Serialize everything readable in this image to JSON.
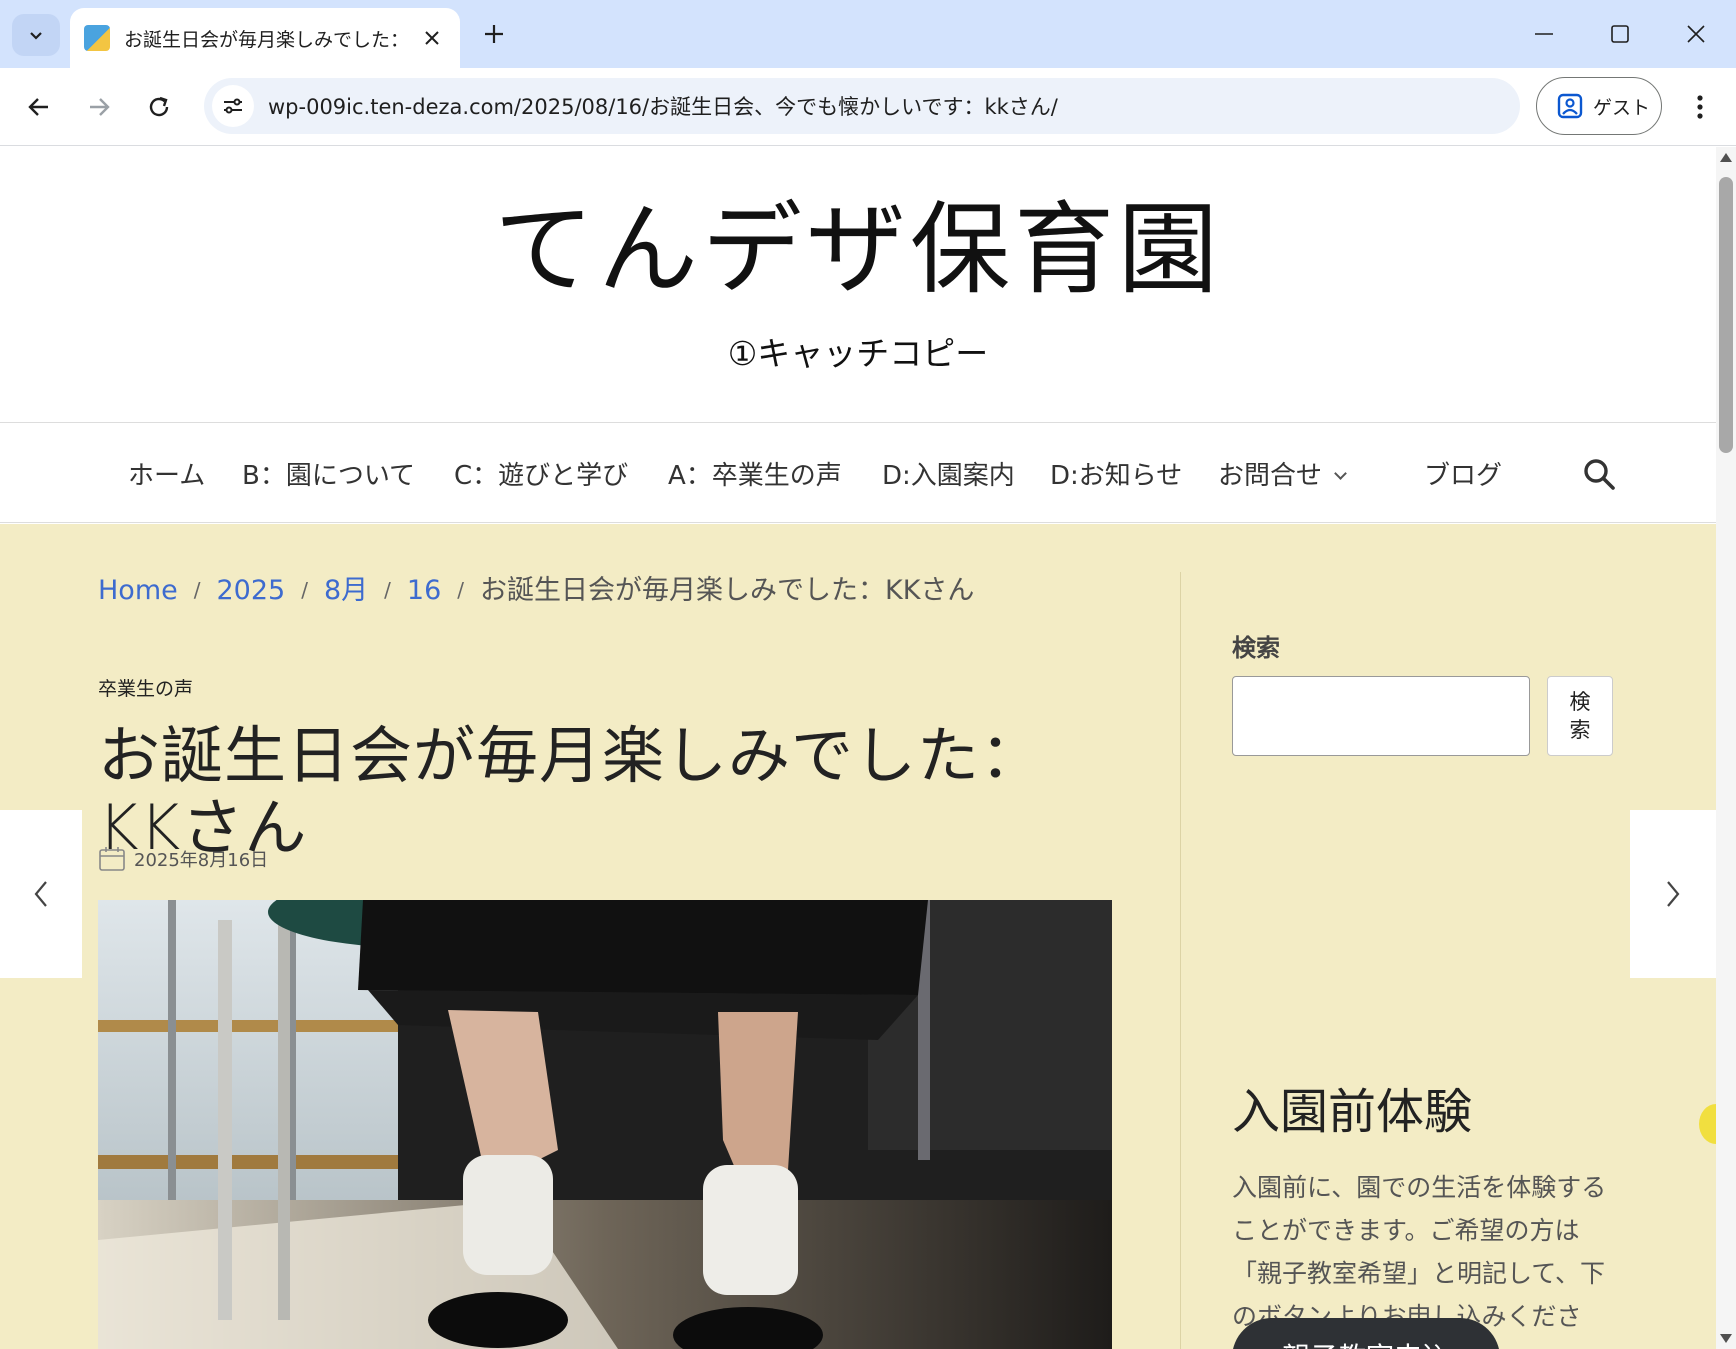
{
  "browser": {
    "tab_title": "お誕生日会が毎月楽しみでした：KKさん",
    "url": "wp-009ic.ten-deza.com/2025/08/16/お誕生日会、今でも懐かしいです：kkさん/",
    "profile_label": "ゲスト"
  },
  "site": {
    "title": "てんデザ保育園",
    "tagline": "①キャッチコピー"
  },
  "nav": {
    "items": [
      "ホーム",
      "B：園について",
      "C：遊びと学び",
      "A：卒業生の声",
      "D:入園案内",
      "D:お知らせ",
      "お問合せ",
      "ブログ"
    ]
  },
  "breadcrumb": {
    "home": "Home",
    "year": "2025",
    "month": "8月",
    "day": "16",
    "current": "お誕生日会が毎月楽しみでした：KKさん",
    "separator": "/"
  },
  "post": {
    "category": "卒業生の声",
    "title": "お誕生日会が毎月楽しみでした：KKさん",
    "date": "2025年8月16日"
  },
  "sidebar": {
    "search_label": "検索",
    "search_button": "検索",
    "widget_title": "入園前体験",
    "widget_text": "入園前に、園での生活を体験することができます。ご希望の方は「親子教室希望」と明記して、下のボタンよりお申し込みください。",
    "cta_label": "親子教室申込"
  },
  "colors": {
    "content_bg": "#f3ecc5",
    "link": "#3d6bcf",
    "cta_bg": "#2e3135",
    "tabbar_bg": "#d3e3fd"
  }
}
